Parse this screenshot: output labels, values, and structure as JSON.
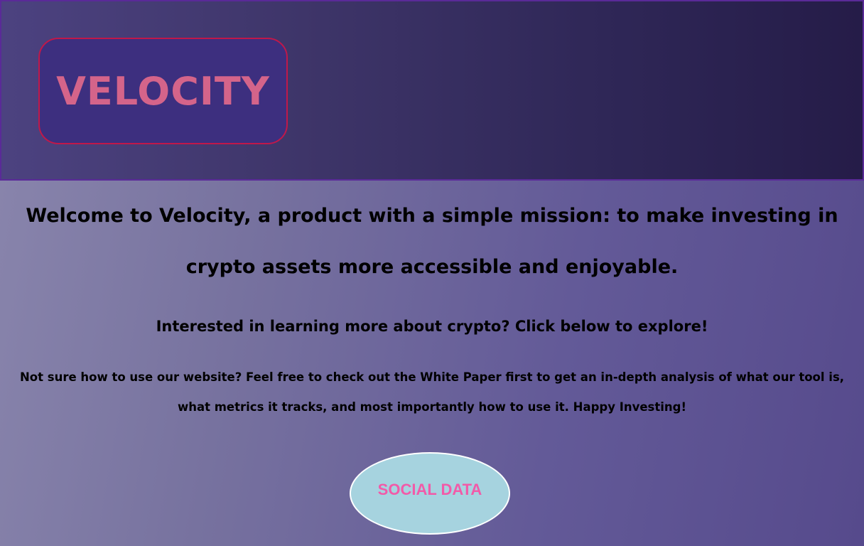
{
  "header": {
    "logo_text": "VELOCITY"
  },
  "main": {
    "welcome": "Welcome to Velocity, a product with a simple mission: to make investing in crypto assets more accessible and enjoyable.",
    "interested": "Interested in learning more about crypto? Click below to explore!",
    "not_sure": "Not sure how to use our website? Feel free to check out the White Paper first to get an in-depth analysis of what our tool is, what metrics it tracks, and most importantly how to use it. Happy Investing!"
  },
  "cta": {
    "social_data_label": "SOCIAL DATA"
  },
  "colors": {
    "header_bg": "#3e3569",
    "logo_border": "#c0184a",
    "logo_text": "#d4648a",
    "button_bg": "#a6d3df",
    "button_text": "#f25aa8"
  }
}
